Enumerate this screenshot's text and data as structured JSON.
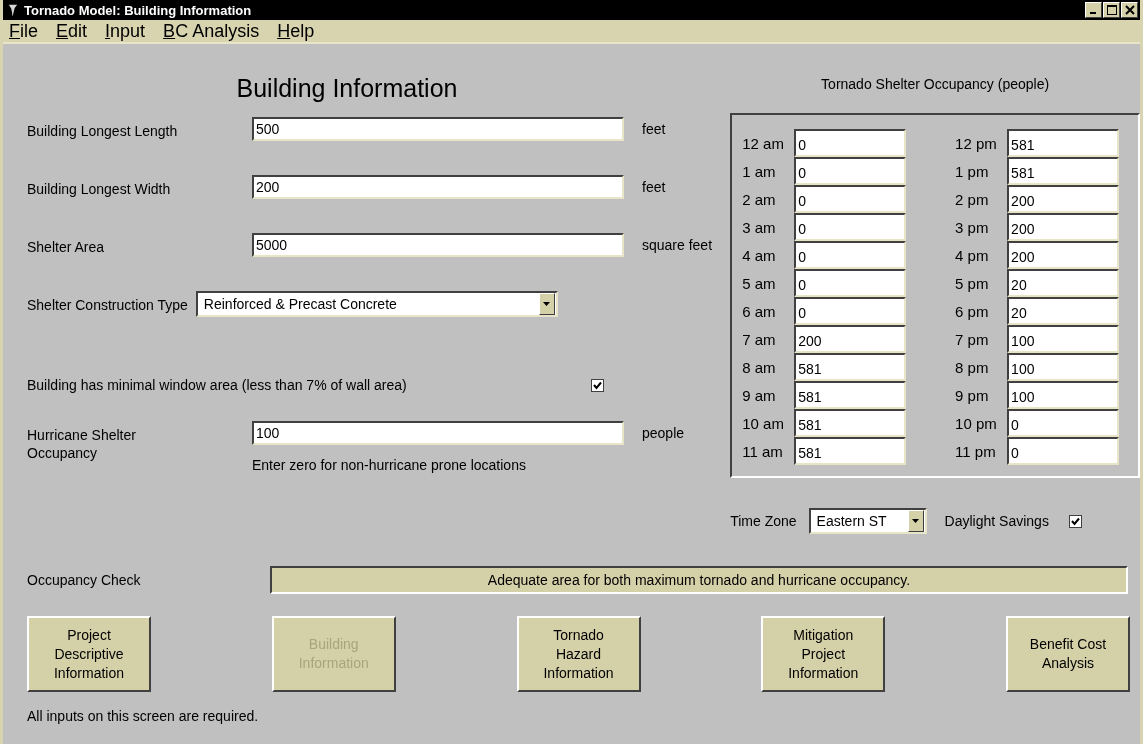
{
  "window": {
    "title": "Tornado Model: Building Information"
  },
  "menu": [
    {
      "accel": "F",
      "rest": "ile"
    },
    {
      "accel": "E",
      "rest": "dit"
    },
    {
      "accel": "I",
      "rest": "nput"
    },
    {
      "accel": "B",
      "rest": "C Analysis"
    },
    {
      "accel": "H",
      "rest": "elp"
    }
  ],
  "heading": "Building Information",
  "fields": [
    {
      "kind": "text",
      "label": "Building Longest Length",
      "value": "500",
      "unit": "feet"
    },
    {
      "kind": "text",
      "label": "Building Longest Width",
      "value": "200",
      "unit": "feet"
    },
    {
      "kind": "text",
      "label": "Shelter Area",
      "value": "5000",
      "unit": "square feet"
    },
    {
      "kind": "select",
      "label": "Shelter Construction Type",
      "value": "Reinforced & Precast Concrete"
    },
    {
      "kind": "checkbox",
      "label": "Building has minimal window area (less than 7% of wall area)",
      "checked": true
    },
    {
      "kind": "text",
      "label": "Hurricane Shelter Occupancy",
      "value": "100",
      "unit": "people",
      "hint": "Enter zero for non-hurricane prone locations"
    }
  ],
  "occupancy": {
    "title": "Tornado Shelter Occupancy (people)",
    "am": [
      {
        "hour": "12 am",
        "value": "0"
      },
      {
        "hour": "1 am",
        "value": "0"
      },
      {
        "hour": "2 am",
        "value": "0"
      },
      {
        "hour": "3 am",
        "value": "0"
      },
      {
        "hour": "4 am",
        "value": "0"
      },
      {
        "hour": "5 am",
        "value": "0"
      },
      {
        "hour": "6 am",
        "value": "0"
      },
      {
        "hour": "7 am",
        "value": "200"
      },
      {
        "hour": "8 am",
        "value": "581"
      },
      {
        "hour": "9 am",
        "value": "581"
      },
      {
        "hour": "10 am",
        "value": "581"
      },
      {
        "hour": "11 am",
        "value": "581"
      }
    ],
    "pm": [
      {
        "hour": "12 pm",
        "value": "581"
      },
      {
        "hour": "1 pm",
        "value": "581"
      },
      {
        "hour": "2 pm",
        "value": "200"
      },
      {
        "hour": "3 pm",
        "value": "200"
      },
      {
        "hour": "4 pm",
        "value": "200"
      },
      {
        "hour": "5 pm",
        "value": "20"
      },
      {
        "hour": "6 pm",
        "value": "20"
      },
      {
        "hour": "7 pm",
        "value": "100"
      },
      {
        "hour": "8 pm",
        "value": "100"
      },
      {
        "hour": "9 pm",
        "value": "100"
      },
      {
        "hour": "10 pm",
        "value": "0"
      },
      {
        "hour": "11 pm",
        "value": "0"
      }
    ],
    "time_zone_label": "Time Zone",
    "time_zone": "Eastern ST",
    "daylight_label": "Daylight Savings",
    "daylight_savings": true
  },
  "occupancy_check": {
    "label": "Occupancy Check",
    "message": "Adequate area for both maximum tornado and hurricane occupancy."
  },
  "nav_buttons": [
    {
      "label": "Project Descriptive Information",
      "disabled": false
    },
    {
      "label": "Building Information",
      "disabled": true
    },
    {
      "label": "Tornado Hazard Information",
      "disabled": false
    },
    {
      "label": "Mitigation Project Information",
      "disabled": false
    },
    {
      "label": "Benefit Cost Analysis",
      "disabled": false
    }
  ],
  "status": "All inputs on this screen are required."
}
